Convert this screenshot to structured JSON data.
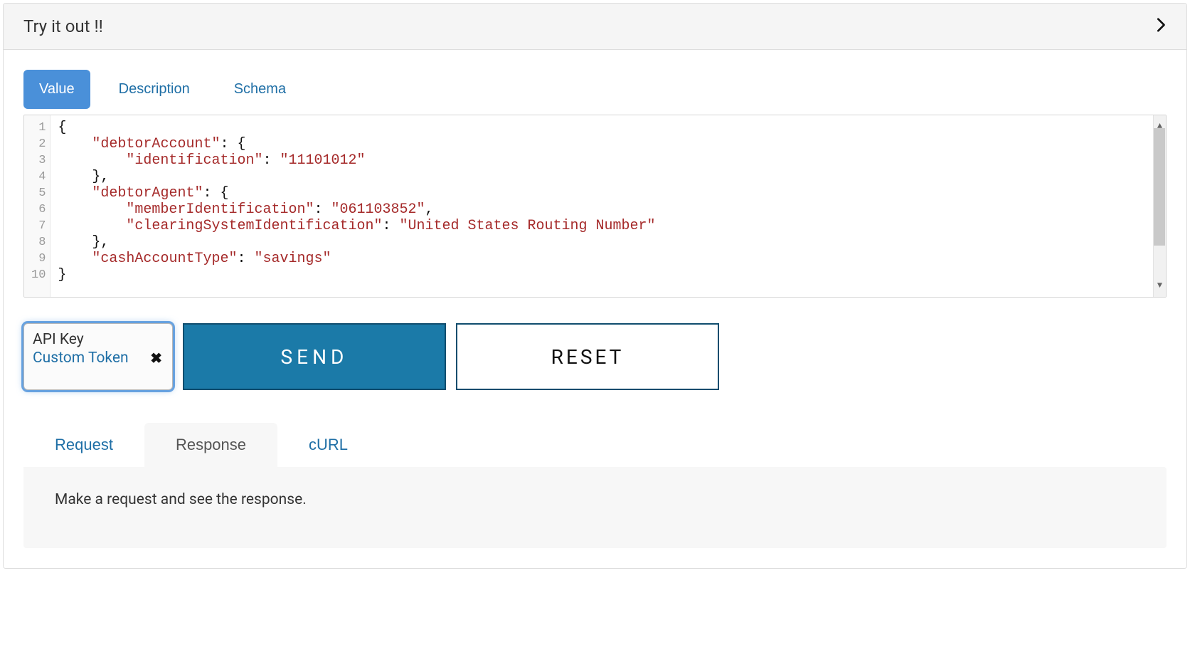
{
  "header": {
    "title": "Try it out !!"
  },
  "tabs_top": [
    {
      "label": "Value",
      "active": true
    },
    {
      "label": "Description",
      "active": false
    },
    {
      "label": "Schema",
      "active": false
    }
  ],
  "editor": {
    "line_numbers": [
      "1",
      "2",
      "3",
      "4",
      "5",
      "6",
      "7",
      "8",
      "9",
      "10"
    ],
    "json_payload": {
      "debtorAccount": {
        "identification": "11101012"
      },
      "debtorAgent": {
        "memberIdentification": "061103852",
        "clearingSystemIdentification": "United States Routing Number"
      },
      "cashAccountType": "savings"
    },
    "tokens": {
      "l1": "{",
      "l2_key": "\"debtorAccount\"",
      "l2_rest": ": {",
      "l3_key": "\"identification\"",
      "l3_rest": ": ",
      "l3_val": "\"11101012\"",
      "l4": "},",
      "l5_key": "\"debtorAgent\"",
      "l5_rest": ": {",
      "l6_key": "\"memberIdentification\"",
      "l6_rest": ": ",
      "l6_val": "\"061103852\"",
      "l6_comma": ",",
      "l7_key": "\"clearingSystemIdentification\"",
      "l7_rest": ": ",
      "l7_val": "\"United States Routing Number\"",
      "l8": "},",
      "l9_key": "\"cashAccountType\"",
      "l9_rest": ": ",
      "l9_val": "\"savings\"",
      "l10": "}"
    }
  },
  "api_key": {
    "label": "API Key",
    "link": "Custom Token"
  },
  "buttons": {
    "send": "SEND",
    "reset": "RESET"
  },
  "tabs_bottom": [
    {
      "label": "Request",
      "active": false
    },
    {
      "label": "Response",
      "active": true
    },
    {
      "label": "cURL",
      "active": false
    }
  ],
  "response_placeholder": "Make a request and see the response."
}
